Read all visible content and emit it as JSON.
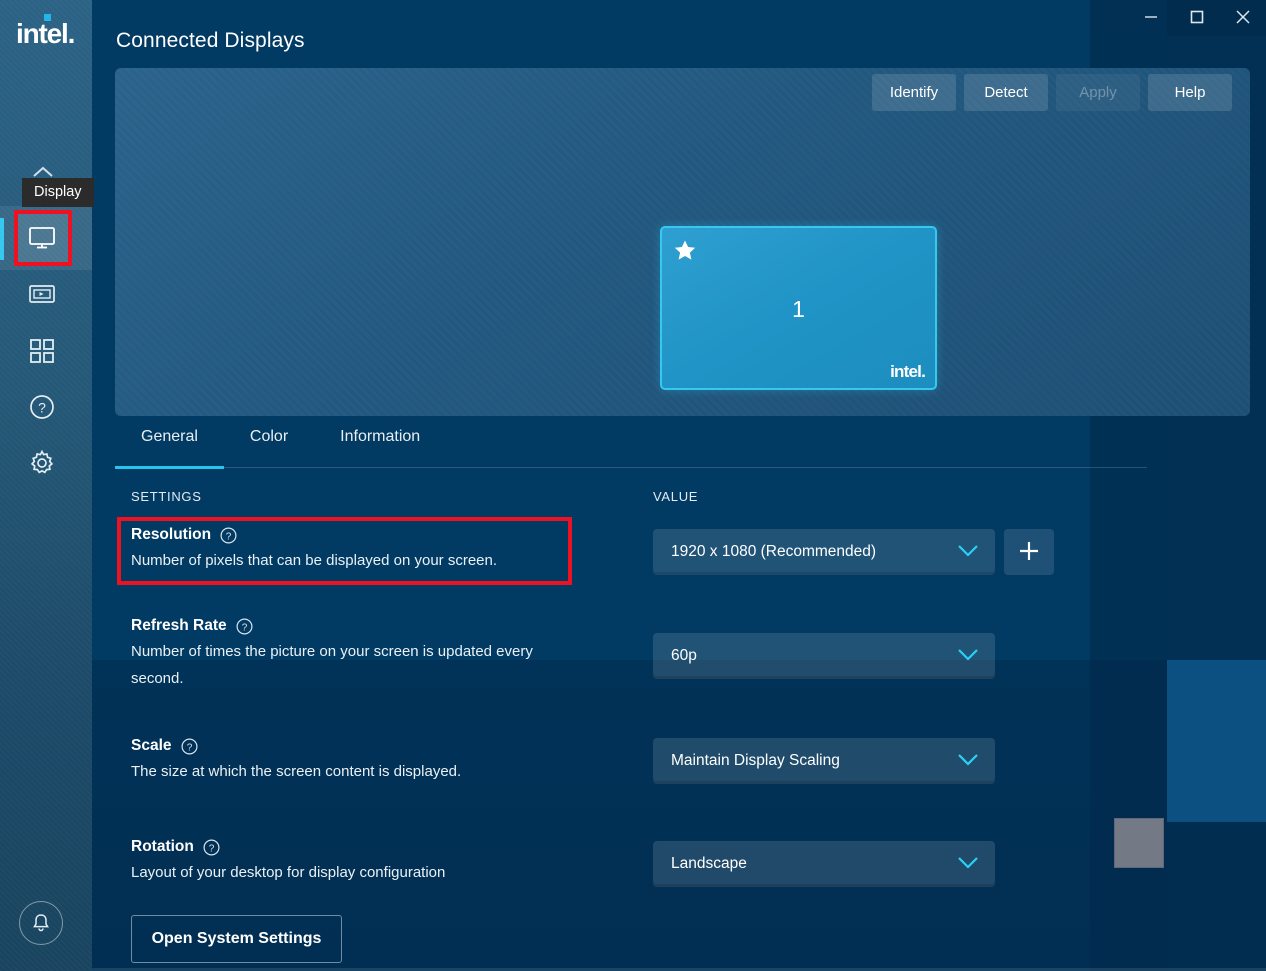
{
  "window": {
    "controls": [
      {
        "name": "minimize",
        "glyph": "minimize-icon"
      },
      {
        "name": "maximize",
        "glyph": "maximize-icon"
      },
      {
        "name": "close",
        "glyph": "close-icon"
      }
    ]
  },
  "brand": {
    "logo_text": "intel",
    "logo_dot": "."
  },
  "sidebar": {
    "items": [
      {
        "id": "display",
        "icon": "monitor-icon",
        "label": "Display",
        "active": true,
        "highlighted": true
      },
      {
        "id": "video",
        "icon": "video-icon",
        "label": "Video",
        "active": false
      },
      {
        "id": "apps",
        "icon": "grid-apps-icon",
        "label": "Apps",
        "active": false
      },
      {
        "id": "support",
        "icon": "question-circle-icon",
        "label": "Support",
        "active": false
      },
      {
        "id": "system",
        "icon": "gear-icon",
        "label": "System",
        "active": false
      }
    ],
    "notification": {
      "icon": "bell-icon",
      "label": "Notifications"
    },
    "tooltip": "Display"
  },
  "header": {
    "title": "Connected Displays"
  },
  "toolbar": {
    "buttons": [
      {
        "label": "Identify",
        "disabled": false
      },
      {
        "label": "Detect",
        "disabled": false
      },
      {
        "label": "Apply",
        "disabled": true
      },
      {
        "label": "Help",
        "disabled": false
      }
    ]
  },
  "preview": {
    "display": {
      "number": "1",
      "primary_icon": "star-icon",
      "logo_text": "intel",
      "logo_dot": "."
    }
  },
  "tabs": [
    {
      "label": "General",
      "active": true
    },
    {
      "label": "Color",
      "active": false
    },
    {
      "label": "Information",
      "active": false
    }
  ],
  "columns": {
    "settings": "SETTINGS",
    "value": "VALUE"
  },
  "settings_rows": [
    {
      "title": "Resolution",
      "description": "Number of pixels that can be displayed on your screen.",
      "help_icon": "question-circle-icon",
      "value": "1920 x 1080 (Recommended)",
      "has_add_button": true,
      "highlighted": true
    },
    {
      "title": "Refresh Rate",
      "description": "Number of times the picture on your screen is updated every second.",
      "help_icon": "question-circle-icon",
      "value": "60p",
      "has_add_button": false,
      "highlighted": false
    },
    {
      "title": "Scale",
      "description": "The size at which the screen content is displayed.",
      "help_icon": "question-circle-icon",
      "value": "Maintain Display Scaling",
      "has_add_button": false,
      "highlighted": false
    },
    {
      "title": "Rotation",
      "description": "Layout of your desktop for display configuration",
      "help_icon": "question-circle-icon",
      "value": "Landscape",
      "has_add_button": false,
      "highlighted": false
    }
  ],
  "footer": {
    "open_system_settings": "Open System Settings"
  },
  "add_button": {
    "icon": "plus-icon",
    "label": "Add custom resolution"
  },
  "colors": {
    "accent_cyan": "#27c4ee",
    "highlight_red": "#ee1122",
    "panel_blue": "#22587f",
    "app_background": "#013a63",
    "sidebar_blue": "#245877",
    "display_card": "#2094c6",
    "grey_square": "#747a85"
  }
}
